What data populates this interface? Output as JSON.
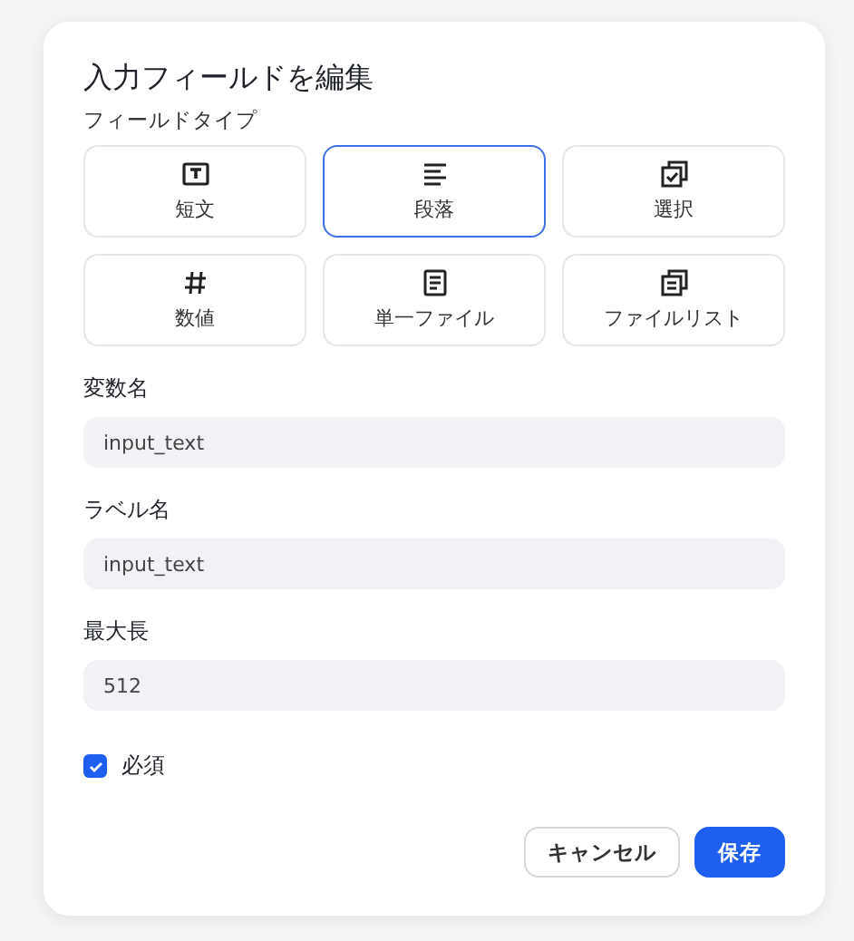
{
  "dialog": {
    "title": "入力フィールドを編集"
  },
  "field_type": {
    "label": "フィールドタイプ",
    "options": [
      {
        "kind": "short",
        "label": "短文",
        "selected": false
      },
      {
        "kind": "paragraph",
        "label": "段落",
        "selected": true
      },
      {
        "kind": "select",
        "label": "選択",
        "selected": false
      },
      {
        "kind": "number",
        "label": "数値",
        "selected": false
      },
      {
        "kind": "file",
        "label": "単一ファイル",
        "selected": false
      },
      {
        "kind": "filelist",
        "label": "ファイルリスト",
        "selected": false
      }
    ]
  },
  "fields": [
    {
      "label": "変数名",
      "value": "input_text"
    },
    {
      "label": "ラベル名",
      "value": "input_text"
    },
    {
      "label": "最大長",
      "value": "512"
    }
  ],
  "required": {
    "label": "必須",
    "checked": true
  },
  "buttons": [
    {
      "kind": "secondary",
      "label": "キャンセル"
    },
    {
      "kind": "primary",
      "label": "保存"
    }
  ]
}
